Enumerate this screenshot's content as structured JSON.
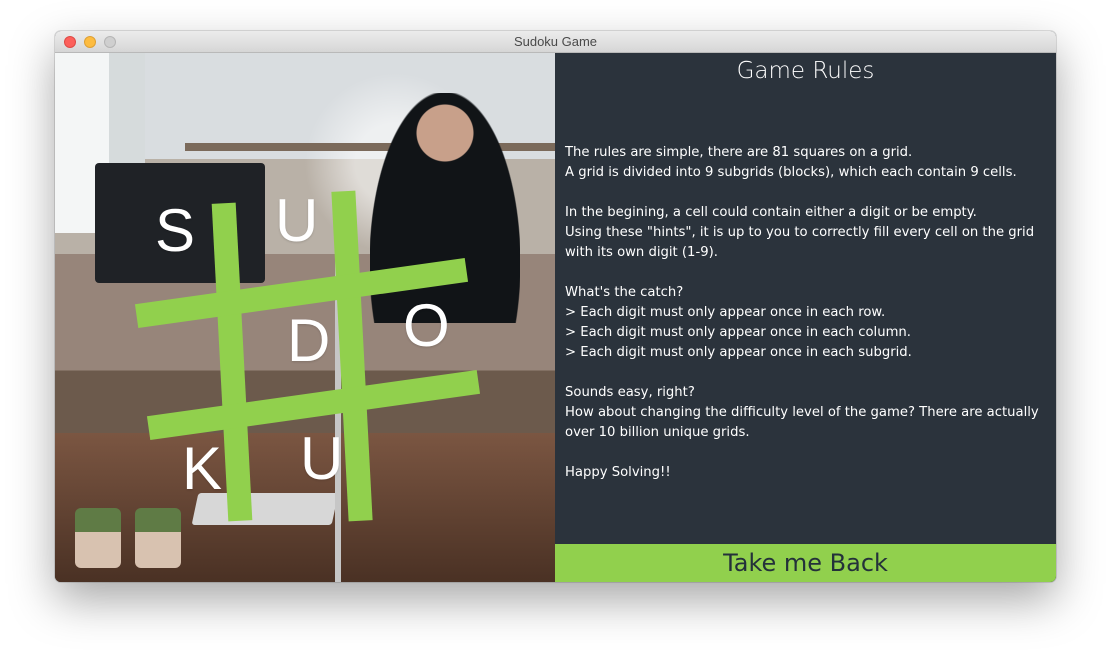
{
  "window": {
    "title": "Sudoku Game"
  },
  "logo": {
    "letters": [
      "S",
      "U",
      "D",
      "O",
      "K",
      "U"
    ],
    "accent_color": "#91d04d"
  },
  "rules": {
    "title": "Game Rules",
    "lines": [
      "The rules are simple, there are 81 squares on a grid.",
      "A grid is divided into 9 subgrids (blocks), which each contain 9 cells.",
      "",
      "In the begining, a cell could contain either a digit or be empty.",
      "Using these \"hints\", it is up to you to correctly fill every cell on the grid",
      "with its own digit (1-9).",
      "",
      "What's the catch?",
      "> Each digit must only appear once in each row.",
      "> Each digit must only appear once in each column.",
      "> Each digit must only appear once in each subgrid.",
      "",
      "Sounds easy, right?",
      "How about changing the difficulty level of the game? There are actually",
      "over 10 billion unique grids.",
      "",
      "Happy Solving!!"
    ]
  },
  "back_button": {
    "label": "Take me Back",
    "color": "#91d04d"
  },
  "colors": {
    "panel_bg": "#2b333c",
    "text": "#ffffff"
  }
}
